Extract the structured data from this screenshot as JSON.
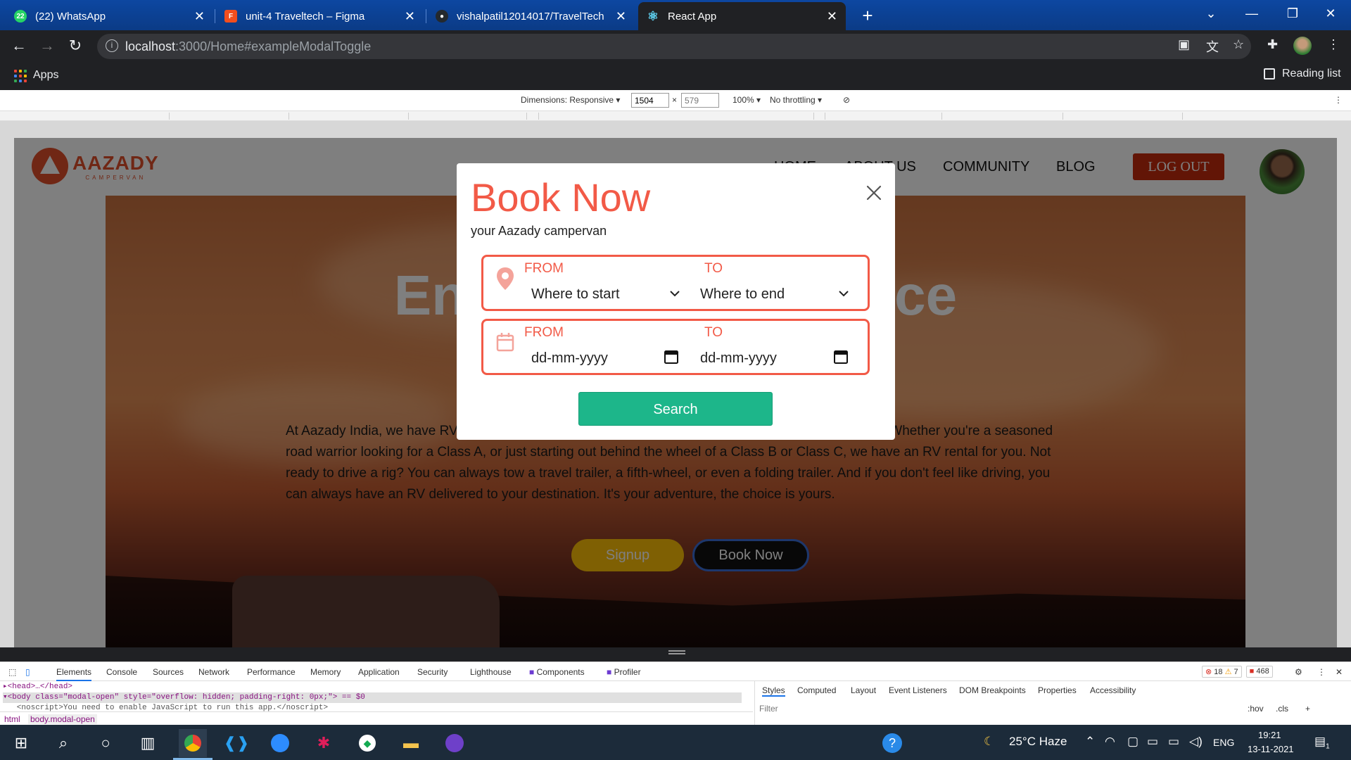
{
  "browser": {
    "tabs": [
      {
        "title": "(22) WhatsApp",
        "favicon": "whatsapp-icon",
        "color": "#25d366",
        "glyph": "22"
      },
      {
        "title": "unit-4 Traveltech – Figma",
        "favicon": "figma-icon",
        "color": "#f24e1e",
        "glyph": "F"
      },
      {
        "title": "vishalpatil12014017/TravelTech",
        "favicon": "github-icon",
        "color": "#24292e",
        "glyph": "G"
      },
      {
        "title": "React App",
        "favicon": "react-icon",
        "color": "#61dafb",
        "glyph": "⚛"
      }
    ],
    "url_host": "localhost",
    "url_path": ":3000/Home#exampleModalToggle",
    "bookmarks": {
      "apps": "Apps",
      "reading_list": "Reading list"
    }
  },
  "device_toolbar": {
    "dimensions_label": "Dimensions: Responsive",
    "width": "1504",
    "height": "579",
    "zoom": "100%",
    "throttling": "No throttling"
  },
  "site": {
    "logo_name": "AAZADY",
    "logo_sub": "CAMPERVAN",
    "nav": [
      "HOME",
      "ABOUT US",
      "COMMUNITY",
      "BLOG"
    ],
    "logout": "LOG OUT",
    "hero_title": "Enjoy the experience",
    "hero_text": "At Aazady India, we have RVs and campervans for every traveler and every journey you can imagine. Whether you're a seasoned road warrior looking for a Class A, or just starting out behind the wheel of a Class B or Class C, we have an RV rental for you. Not ready to drive a rig? You can always tow a travel trailer, a fifth-wheel, or even a folding trailer. And if you don't feel like driving, you can always have an RV delivered to your destination. It's your adventure, the choice is yours.",
    "signup": "Signup",
    "book_now": "Book Now"
  },
  "modal": {
    "title": "Book Now",
    "subtitle": "your Aazady campervan",
    "location": {
      "from_label": "FROM",
      "to_label": "TO",
      "from_value": "Where to start",
      "to_value": "Where to end"
    },
    "dates": {
      "from_label": "FROM",
      "to_label": "TO",
      "from_value": "dd-mm-yyyy",
      "to_value": "dd-mm-yyyy"
    },
    "search": "Search"
  },
  "devtools": {
    "tabs": [
      "Elements",
      "Console",
      "Sources",
      "Network",
      "Performance",
      "Memory",
      "Application",
      "Security",
      "Lighthouse",
      "Components",
      "Profiler"
    ],
    "errors": "18",
    "warnings": "7",
    "issues": "468",
    "code_line1": "▸<head>…</head>",
    "code_line2": "▾<body class=\"modal-open\" style=\"overflow: hidden; padding-right: 0px;\"> == $0",
    "code_line3": "   <noscript>You need to enable JavaScript to run this app.</noscript>",
    "crumbs": [
      "html",
      "body.modal-open"
    ],
    "styles_tabs": [
      "Styles",
      "Computed",
      "Layout",
      "Event Listeners",
      "DOM Breakpoints",
      "Properties",
      "Accessibility"
    ],
    "filter": "Filter",
    "hov": ":hov",
    "cls": ".cls"
  },
  "taskbar": {
    "weather": "25°C  Haze",
    "lang": "ENG",
    "time": "19:21",
    "date": "13-11-2021",
    "notifications": "1"
  },
  "colors": {
    "accent": "#f25a47",
    "search": "#1db68a",
    "logout": "#c42b0d"
  }
}
